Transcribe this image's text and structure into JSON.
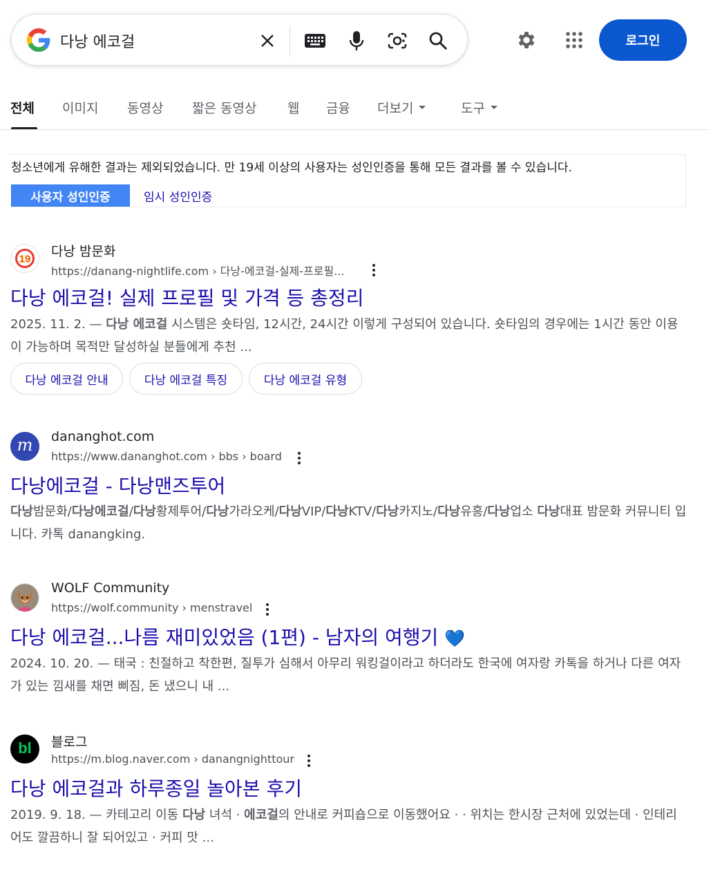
{
  "search": {
    "query": "다낭 에코걸"
  },
  "header": {
    "login_label": "로그인"
  },
  "tabs": [
    {
      "label": "전체"
    },
    {
      "label": "이미지"
    },
    {
      "label": "동영상"
    },
    {
      "label": "짧은 동영상"
    },
    {
      "label": "웹"
    },
    {
      "label": "금융"
    },
    {
      "label": "더보기"
    },
    {
      "label": "도구"
    }
  ],
  "notice": {
    "text": "청소년에게 유해한 결과는 제외되었습니다. 만 19세 이상의 사용자는 성인인증을 통해 모든 결과를 볼 수 있습니다.",
    "verify_label": "사용자 성인인증",
    "temp_label": "임시 성인인증"
  },
  "results": [
    {
      "site_name": "다낭 밤문화",
      "url": "https://danang-nightlife.com › 다낭-에코걸-실제-프로필...",
      "favicon_text": "19",
      "title": "다낭 에코걸! 실제 프로필 및 가격 등 총정리",
      "date": "2025. 11. 2. — ",
      "snippet_bold": "다낭 에코걸",
      "snippet_rest": " 시스템은 숏타임, 12시간, 24시간 이렇게 구성되어 있습니다. 숏타임의 경우에는 1시간 동안 이용이 가능하며 목적만 달성하실 분들에게 추천 ...",
      "chips": [
        "다낭 에코걸 안내",
        "다낭 에코걸 특징",
        "다낭 에코걸 유형"
      ]
    },
    {
      "site_name": "dananghot.com",
      "url": "https://www.dananghot.com › bbs › board",
      "favicon_text": "m",
      "title": "다낭에코걸 - 다낭맨즈투어",
      "snippet_parts": [
        {
          "t": "다낭",
          "b": true
        },
        {
          "t": "밤문화/",
          "b": false
        },
        {
          "t": "다낭에코걸",
          "b": true
        },
        {
          "t": "/",
          "b": false
        },
        {
          "t": "다낭",
          "b": true
        },
        {
          "t": "황제투어/",
          "b": false
        },
        {
          "t": "다낭",
          "b": true
        },
        {
          "t": "가라오케/",
          "b": false
        },
        {
          "t": "다낭",
          "b": true
        },
        {
          "t": "VIP/",
          "b": false
        },
        {
          "t": "다낭",
          "b": true
        },
        {
          "t": "KTV/",
          "b": false
        },
        {
          "t": "다낭",
          "b": true
        },
        {
          "t": "카지노/",
          "b": false
        },
        {
          "t": "다낭",
          "b": true
        },
        {
          "t": "유흥/",
          "b": false
        },
        {
          "t": "다낭",
          "b": true
        },
        {
          "t": "업소 ",
          "b": false
        },
        {
          "t": "다낭",
          "b": true
        },
        {
          "t": "대표 밤문화 커뮤니티 입니다. 카톡 danangking.",
          "b": false
        }
      ]
    },
    {
      "site_name": "WOLF Community",
      "url": "https://wolf.community › menstravel",
      "title": "다낭 에코걸...나름 재미있었음 (1편) - 남자의 여행기",
      "title_emoji": "💙",
      "date": "2024. 10. 20. — ",
      "snippet_rest": "태국 : 친절하고 착한편, 질투가 심해서 아무리 워킹걸이라고 하더라도 한국에 여자랑 카톡을 하거나 다른 여자가 있는 낌새를 채면 삐짐, 돈 냈으니 내 ..."
    },
    {
      "site_name": "블로그",
      "url": "https://m.blog.naver.com › danangnighttour",
      "favicon_text": "bl",
      "title": "다낭 에코걸과 하루종일 놀아본 후기",
      "date": "2019. 9. 18. — ",
      "snippet_parts": [
        {
          "t": "카테고리 이동 ",
          "b": false
        },
        {
          "t": "다낭",
          "b": true
        },
        {
          "t": " 녀석 · ",
          "b": false
        },
        {
          "t": "에코걸",
          "b": true
        },
        {
          "t": "의 안내로 커피숍으로 이동했어요 · · 위치는 한시장 근처에 있었는데 · 인테리어도 깔끔하니 잘 되어있고 · 커피 맛 ...",
          "b": false
        }
      ]
    }
  ],
  "colors": {
    "link": "#1a0dab",
    "login": "#0b57d0",
    "verify": "#4285f4"
  }
}
